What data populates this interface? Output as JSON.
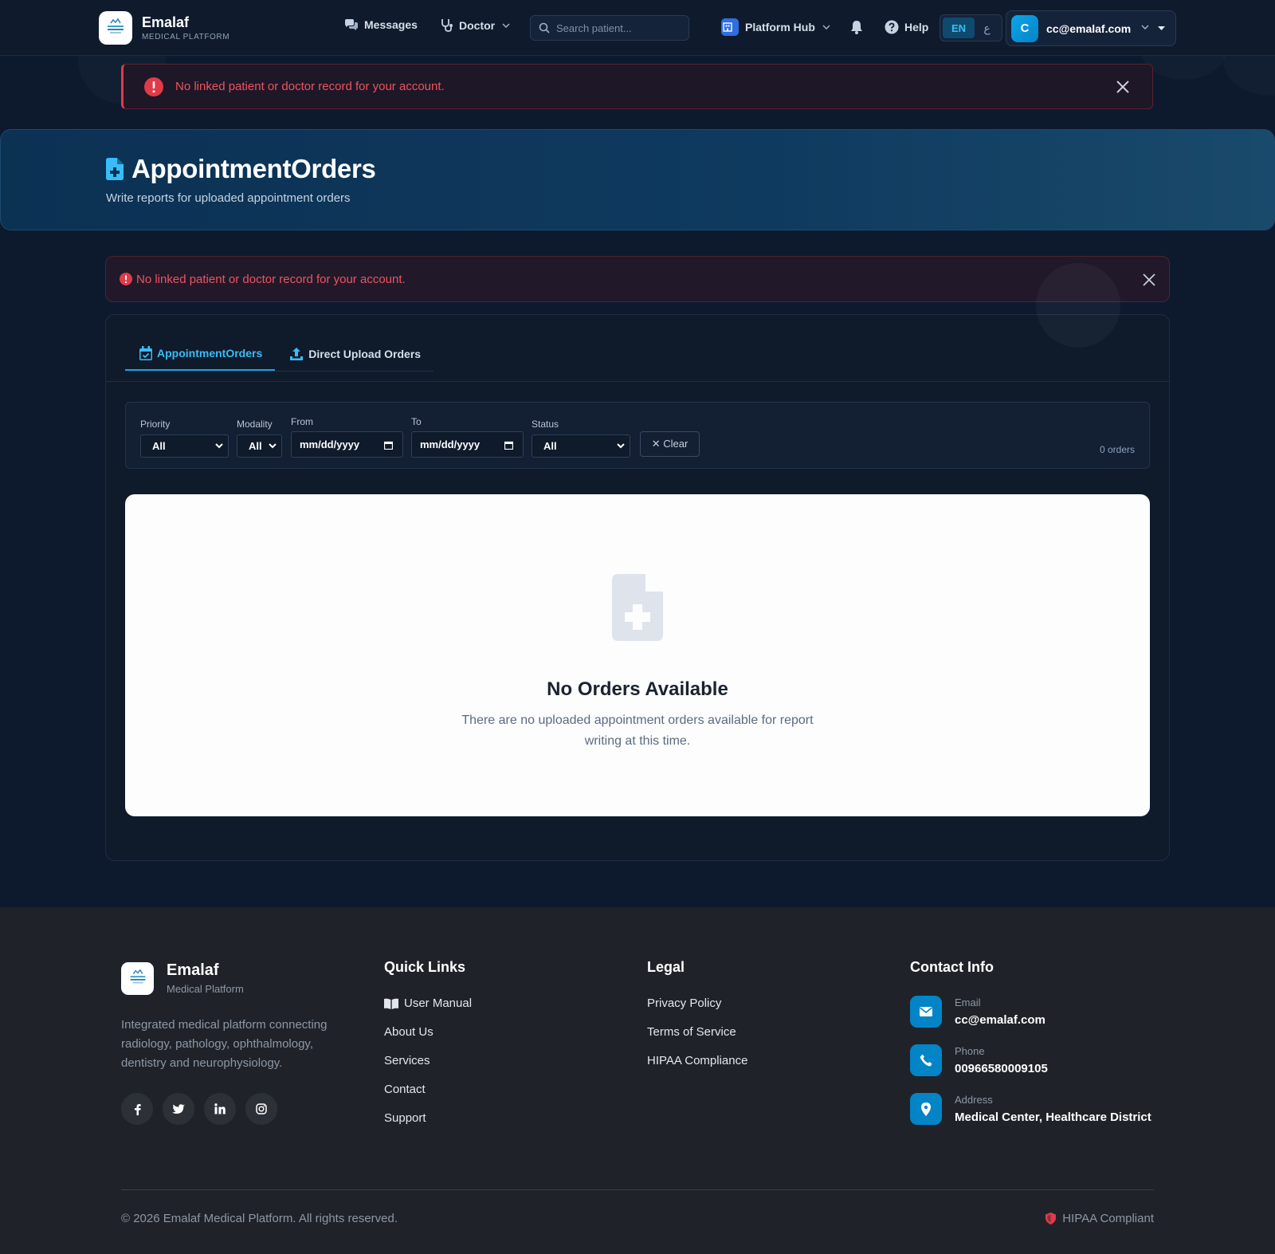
{
  "brand": {
    "name": "Emalaf",
    "subtitle": "MEDICAL PLATFORM"
  },
  "nav": {
    "messages": "Messages",
    "doctor": "Doctor",
    "search_placeholder": "Search patient...",
    "platform_hub": "Platform Hub",
    "help": "Help",
    "lang_en": "EN",
    "lang_ar": "ع",
    "user_initial": "C",
    "user_email": "cc@emalaf.com"
  },
  "alerts": {
    "top": "No linked patient or doctor record for your account.",
    "inline": "No linked patient or doctor record for your account."
  },
  "header": {
    "title": "AppointmentOrders",
    "subtitle": "Write reports for uploaded appointment orders"
  },
  "tabs": [
    {
      "label": "AppointmentOrders",
      "active": true
    },
    {
      "label": "Direct Upload Orders",
      "active": false
    }
  ],
  "filters": {
    "priority_label": "Priority",
    "priority_value": "All",
    "modality_label": "Modality",
    "modality_value": "All",
    "from_label": "From",
    "from_placeholder": "mm/dd/yyyy",
    "to_label": "To",
    "to_placeholder": "mm/dd/yyyy",
    "status_label": "Status",
    "status_value": "All",
    "clear_label": "✕ Clear",
    "count": "0 orders"
  },
  "empty_state": {
    "title": "No Orders Available",
    "message": "There are no uploaded appointment orders available for report writing at this time."
  },
  "footer": {
    "brand_name": "Emalaf",
    "brand_sub": "Medical Platform",
    "description": "Integrated medical platform connecting radiology, pathology, ophthalmology, dentistry and neurophysiology.",
    "quick_links_title": "Quick Links",
    "quick_links": [
      "User Manual",
      "About Us",
      "Services",
      "Contact",
      "Support"
    ],
    "legal_title": "Legal",
    "legal_links": [
      "Privacy Policy",
      "Terms of Service",
      "HIPAA Compliance"
    ],
    "contact_title": "Contact Info",
    "contact": {
      "email_label": "Email",
      "email_value": "cc@emalaf.com",
      "phone_label": "Phone",
      "phone_value": "00966580009105",
      "address_label": "Address",
      "address_value": "Medical Center, Healthcare District"
    },
    "copyright": "© 2026 Emalaf Medical Platform. All rights reserved.",
    "hipaa": "HIPAA Compliant"
  },
  "colors": {
    "accent": "#0ea5e9",
    "alert_red": "#f0525e",
    "navbar_bg": "#0f1b2c",
    "footer_bg": "#1f2329"
  },
  "icons": {
    "messages": "chat-bubbles-icon",
    "doctor": "stethoscope-icon",
    "search": "search-icon",
    "hub": "building-icon",
    "notifications": "bell-icon",
    "help": "question-circle-icon",
    "alert": "exclamation-circle-icon",
    "close": "close-icon",
    "page": "medical-file-icon",
    "tab_appointment": "calendar-check-icon",
    "tab_upload": "upload-icon",
    "empty": "medical-file-icon",
    "socials": [
      "facebook-icon",
      "twitter-icon",
      "linkedin-icon",
      "instagram-icon"
    ],
    "contact": [
      "envelope-icon",
      "phone-icon",
      "map-pin-icon"
    ],
    "hipaa": "shield-icon"
  }
}
